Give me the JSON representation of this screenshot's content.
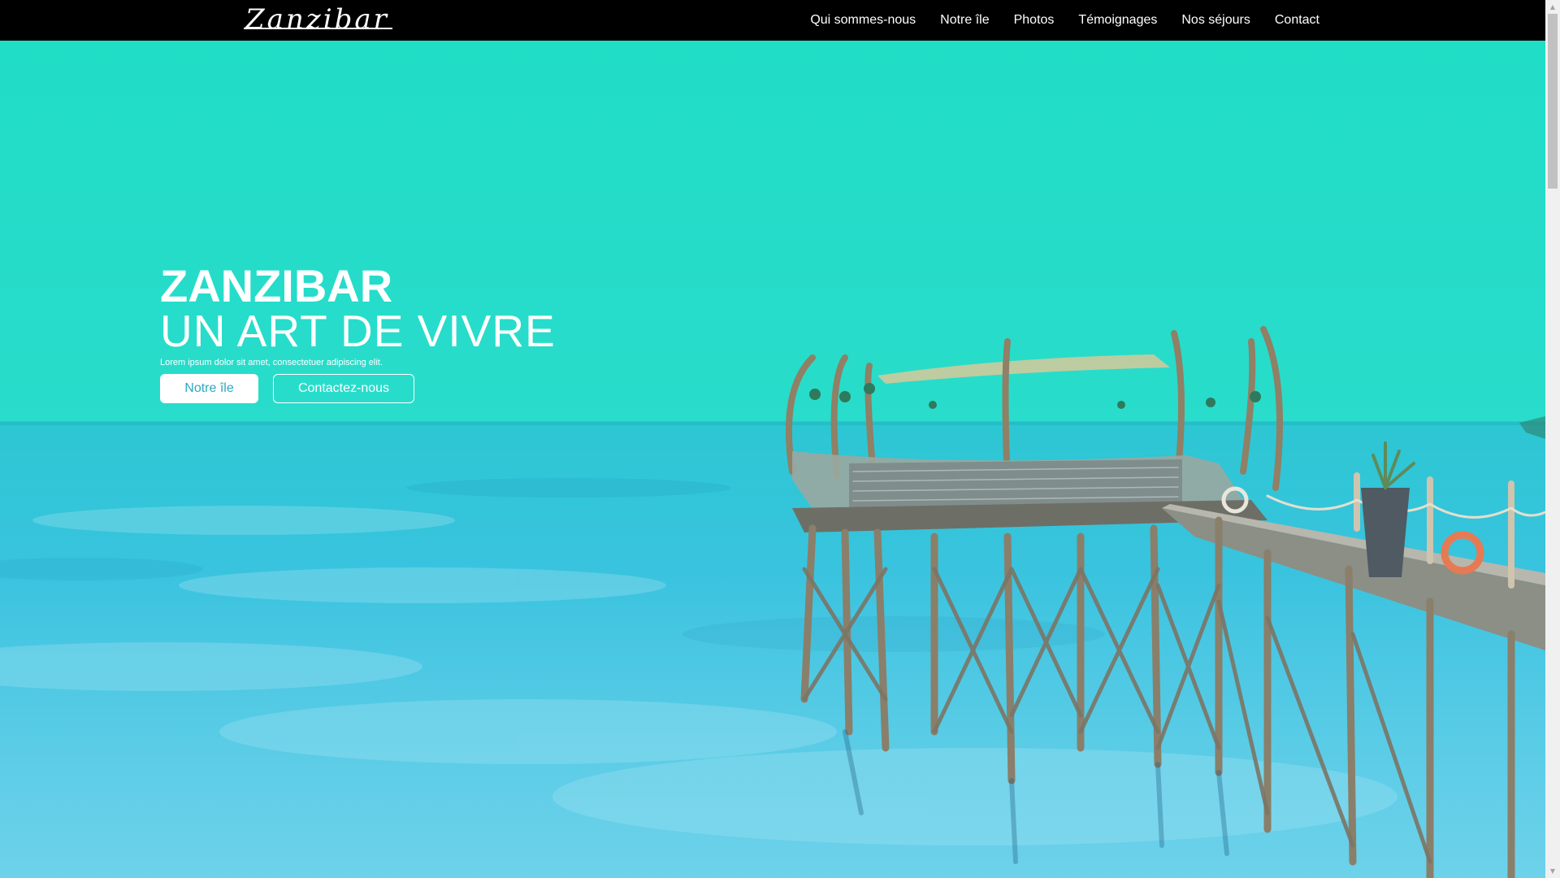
{
  "navbar": {
    "logo": "Zanzibar",
    "links": [
      "Qui sommes-nous",
      "Notre île",
      "Photos",
      "Témoignages",
      "Nos séjours",
      "Contact"
    ]
  },
  "hero": {
    "title": "ZANZIBAR",
    "subtitle": "UN ART DE VIVRE",
    "lead": "Lorem ipsum dolor sit amet, consectetuer adipiscing elit.",
    "primary_button": "Notre île",
    "secondary_button": "Contactez-nous"
  },
  "colors": {
    "navbar": "#000000",
    "sky": "#22d9c6",
    "sea": "#3cc6dc",
    "text": "#ffffff",
    "primary_button_text": "#2aa9c3"
  },
  "icons": {
    "scroll_up": "scroll-up-arrow-icon",
    "scroll_down": "scroll-down-arrow-icon"
  }
}
